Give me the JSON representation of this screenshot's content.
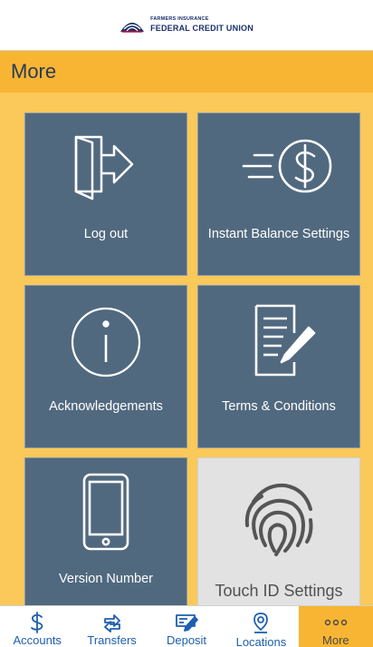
{
  "header": {
    "logo_small": "FARMERS INSURANCE",
    "logo_big": "FEDERAL CREDIT UNION"
  },
  "page": {
    "title": "More"
  },
  "tiles": [
    {
      "label": "Log out",
      "icon": "logout-door-icon"
    },
    {
      "label": "Instant Balance Settings",
      "icon": "fast-dollar-icon"
    },
    {
      "label": "Acknowledgements",
      "icon": "info-icon"
    },
    {
      "label": "Terms & Conditions",
      "icon": "document-pen-icon"
    },
    {
      "label": "Version Number",
      "icon": "phone-icon"
    },
    {
      "label": "Touch ID Settings",
      "icon": "fingerprint-icon"
    }
  ],
  "tabs": [
    {
      "label": "Accounts",
      "icon": "dollar-icon"
    },
    {
      "label": "Transfers",
      "icon": "transfer-arrows-icon"
    },
    {
      "label": "Deposit",
      "icon": "check-deposit-icon"
    },
    {
      "label": "Locations",
      "icon": "location-pin-icon"
    },
    {
      "label": "More",
      "icon": "more-dots-icon",
      "active": true
    }
  ],
  "colors": {
    "tile": "#51697f",
    "accent": "#f7b533",
    "tab_text": "#1e5fb0",
    "title_text": "#2a3a57"
  }
}
